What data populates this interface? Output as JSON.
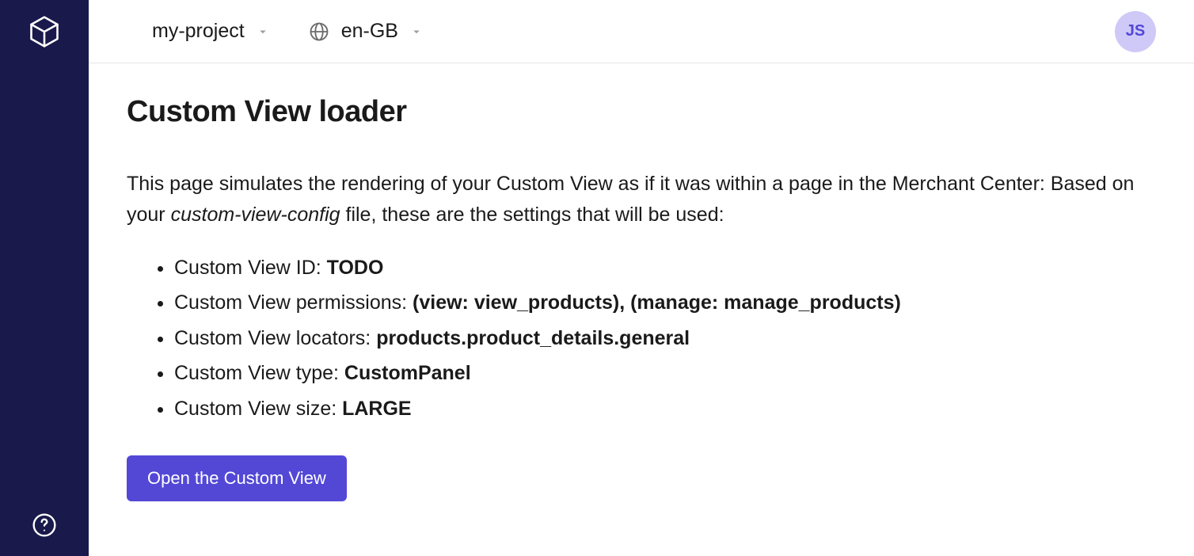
{
  "sidebar": {
    "logo_name": "cube-logo",
    "help_name": "help-icon"
  },
  "topbar": {
    "project_label": "my-project",
    "locale_label": "en-GB",
    "avatar_initials": "JS"
  },
  "page": {
    "title": "Custom View loader",
    "intro_prefix": "This page simulates the rendering of your Custom View as if it was within a page in the Merchant Center: Based on your ",
    "intro_filename": "custom-view-config",
    "intro_suffix": " file, these are the settings that will be used:",
    "settings": [
      {
        "label": "Custom View ID: ",
        "value": "TODO"
      },
      {
        "label": "Custom View permissions: ",
        "value": "(view: view_products), (manage: manage_products)"
      },
      {
        "label": "Custom View locators: ",
        "value": "products.product_details.general"
      },
      {
        "label": "Custom View type: ",
        "value": "CustomPanel"
      },
      {
        "label": "Custom View size: ",
        "value": "LARGE"
      }
    ],
    "open_button_label": "Open the Custom View"
  }
}
